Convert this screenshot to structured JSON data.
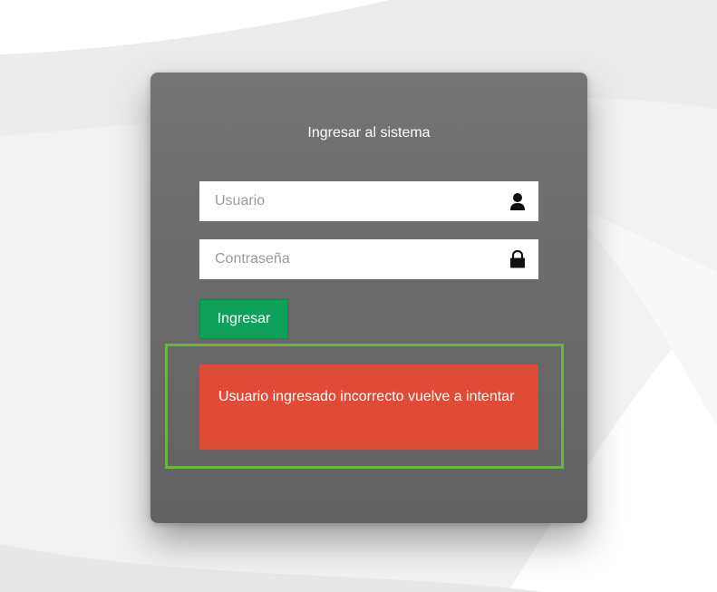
{
  "login": {
    "title": "Ingresar al sistema",
    "username_placeholder": "Usuario",
    "username_value": "",
    "password_placeholder": "Contraseña",
    "password_value": "",
    "submit_label": "Ingresar",
    "error_message": "Usuario ingresado incorrecto vuelve a intentar"
  },
  "icons": {
    "username": "user-icon",
    "password": "lock-icon"
  },
  "colors": {
    "panel": "#6e6e6e",
    "submit_button": "#0da15a",
    "error_alert": "#df4b36",
    "highlight_border": "#6cb33f",
    "background": "#f3f3f3"
  }
}
